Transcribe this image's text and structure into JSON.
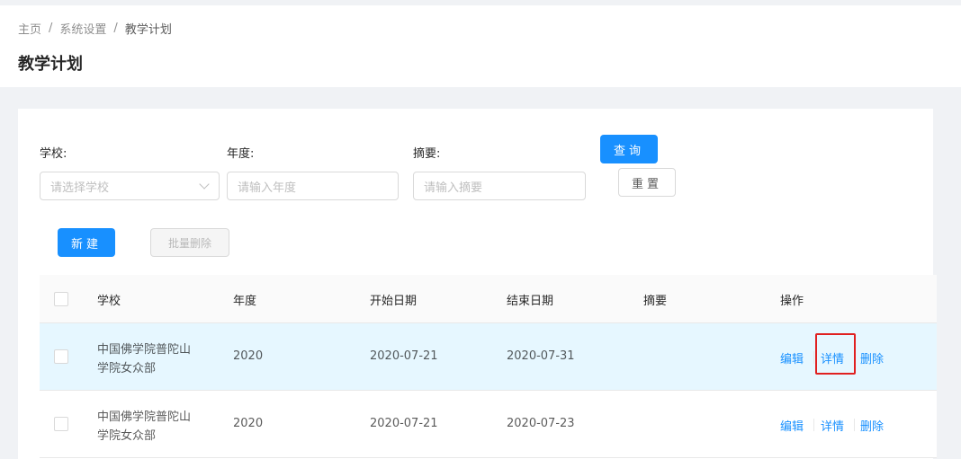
{
  "breadcrumb": [
    "主页",
    "系统设置",
    "教学计划"
  ],
  "breadcrumb_separator": "/",
  "page_title": "教学计划",
  "filters": {
    "school_label": "学校:",
    "school_placeholder": "请选择学校",
    "year_label": "年度:",
    "year_placeholder": "请输入年度",
    "summary_label": "摘要:",
    "summary_placeholder": "请输入摘要",
    "query_button": "查询",
    "reset_button": "重置"
  },
  "toolbar": {
    "new_button": "新建",
    "batch_delete_button": "批量删除"
  },
  "table": {
    "columns": [
      "学校",
      "年度",
      "开始日期",
      "结束日期",
      "摘要",
      "操作"
    ],
    "rows": [
      {
        "school_line1": "中国佛学院普陀山",
        "school_line2": "学院女众部",
        "year": "2020",
        "start_date": "2020-07-21",
        "end_date": "2020-07-31",
        "summary": "",
        "actions": [
          "编辑",
          "详情",
          "删除"
        ]
      },
      {
        "school_line1": "中国佛学院普陀山",
        "school_line2": "学院女众部",
        "year": "2020",
        "start_date": "2020-07-21",
        "end_date": "2020-07-23",
        "summary": "",
        "actions": [
          "编辑",
          "详情",
          "删除"
        ]
      }
    ]
  },
  "colors": {
    "primary": "#1890ff",
    "highlight_row": "#e6f7ff",
    "annotation_red": "#e02020"
  }
}
